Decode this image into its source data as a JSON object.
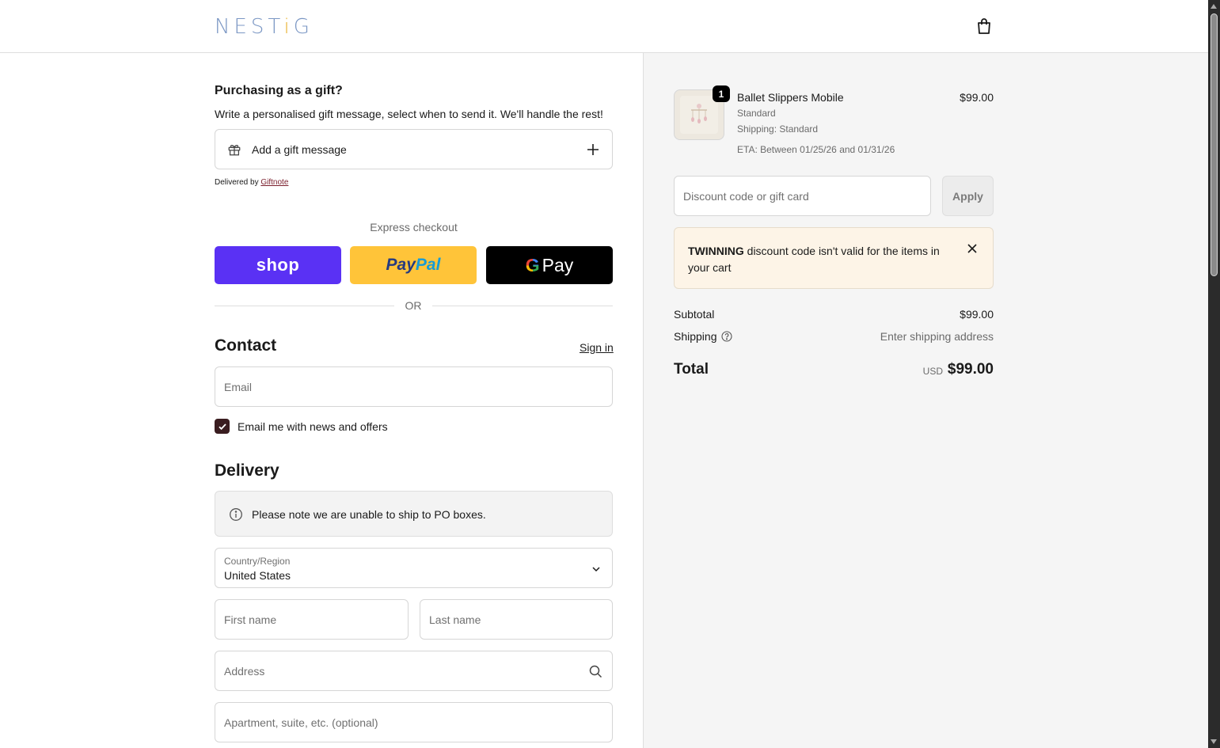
{
  "header": {
    "logo_main": "NEST",
    "logo_accent": "i",
    "logo_end": "G"
  },
  "gift": {
    "heading": "Purchasing as a gift?",
    "description": "Write a personalised gift message, select when to send it. We'll handle the rest!",
    "add_label": "Add a gift message",
    "delivered_prefix": "Delivered by",
    "delivered_link": "Giftnote"
  },
  "express": {
    "label": "Express checkout",
    "shop_label": "shop",
    "paypal_part1": "Pay",
    "paypal_part2": "Pal",
    "gpay_g": "G",
    "gpay_label": "Pay",
    "or_text": "OR"
  },
  "contact": {
    "heading": "Contact",
    "signin_label": "Sign in",
    "email_placeholder": "Email",
    "newsletter_label": "Email me with news and offers",
    "newsletter_checked": true
  },
  "delivery": {
    "heading": "Delivery",
    "notice": "Please note we are unable to ship to PO boxes.",
    "country_label": "Country/Region",
    "country_value": "United States",
    "first_name_placeholder": "First name",
    "last_name_placeholder": "Last name",
    "address_placeholder": "Address",
    "apartment_placeholder": "Apartment, suite, etc. (optional)"
  },
  "order": {
    "item": {
      "name": "Ballet Slippers Mobile",
      "variant": "Standard",
      "shipping": "Shipping: Standard",
      "eta": "ETA: Between 01/25/26 and 01/31/26",
      "price": "$99.00",
      "quantity": "1"
    },
    "discount_placeholder": "Discount code or gift card",
    "apply_label": "Apply",
    "alert_code": "TWINNING",
    "alert_text": " discount code isn't valid for the items in your cart",
    "subtotal_label": "Subtotal",
    "subtotal_value": "$99.00",
    "shipping_label": "Shipping",
    "shipping_value": "Enter shipping address",
    "total_label": "Total",
    "total_currency": "USD",
    "total_value": "$99.00"
  },
  "colors": {
    "shop_purple": "#5a31f4",
    "paypal_yellow": "#ffc439",
    "checkbox_fill": "#3a1d20",
    "alert_bg": "#fdf4e7"
  },
  "icons": [
    "cart-icon",
    "gift-icon",
    "plus-icon",
    "info-icon",
    "chevron-down-icon",
    "search-icon",
    "close-icon",
    "help-icon",
    "check-icon"
  ]
}
